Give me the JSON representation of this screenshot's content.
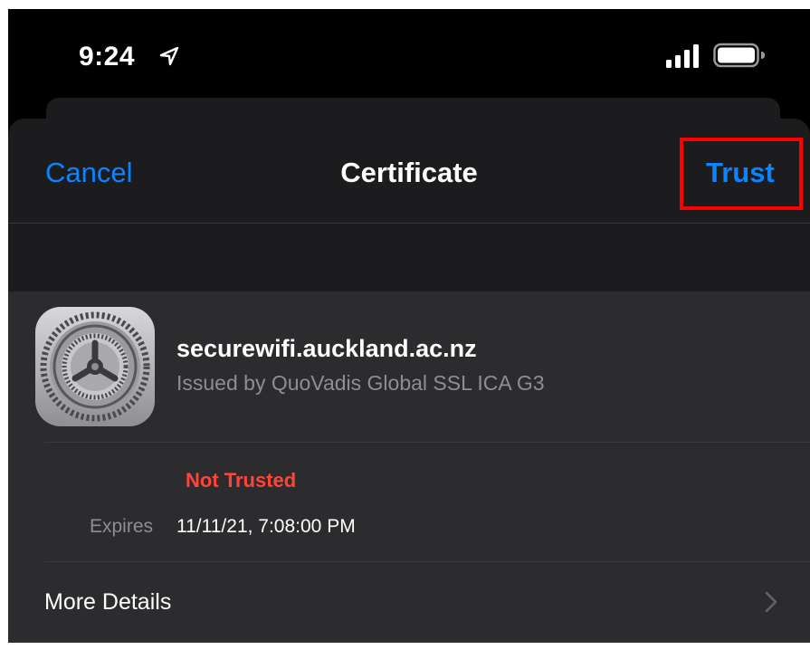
{
  "status_bar": {
    "time": "9:24",
    "icons": [
      "location-arrow-icon",
      "cellular-signal-icon",
      "battery-icon"
    ]
  },
  "nav": {
    "cancel_label": "Cancel",
    "title": "Certificate",
    "trust_label": "Trust"
  },
  "certificate": {
    "icon": "settings-gear-icon",
    "name": "securewifi.auckland.ac.nz",
    "issuer": "Issued by QuoVadis Global SSL ICA G3",
    "status": "Not Trusted",
    "expires_label": "Expires",
    "expires_value": "11/11/21, 7:08:00 PM"
  },
  "more_details": {
    "label": "More Details",
    "icon": "chevron-right-icon"
  },
  "colors": {
    "accent": "#0a84ff",
    "warning": "#ff453a",
    "highlight": "#ff0000",
    "sheet_background": "#1c1c1e",
    "group_background": "#2c2c2e"
  }
}
